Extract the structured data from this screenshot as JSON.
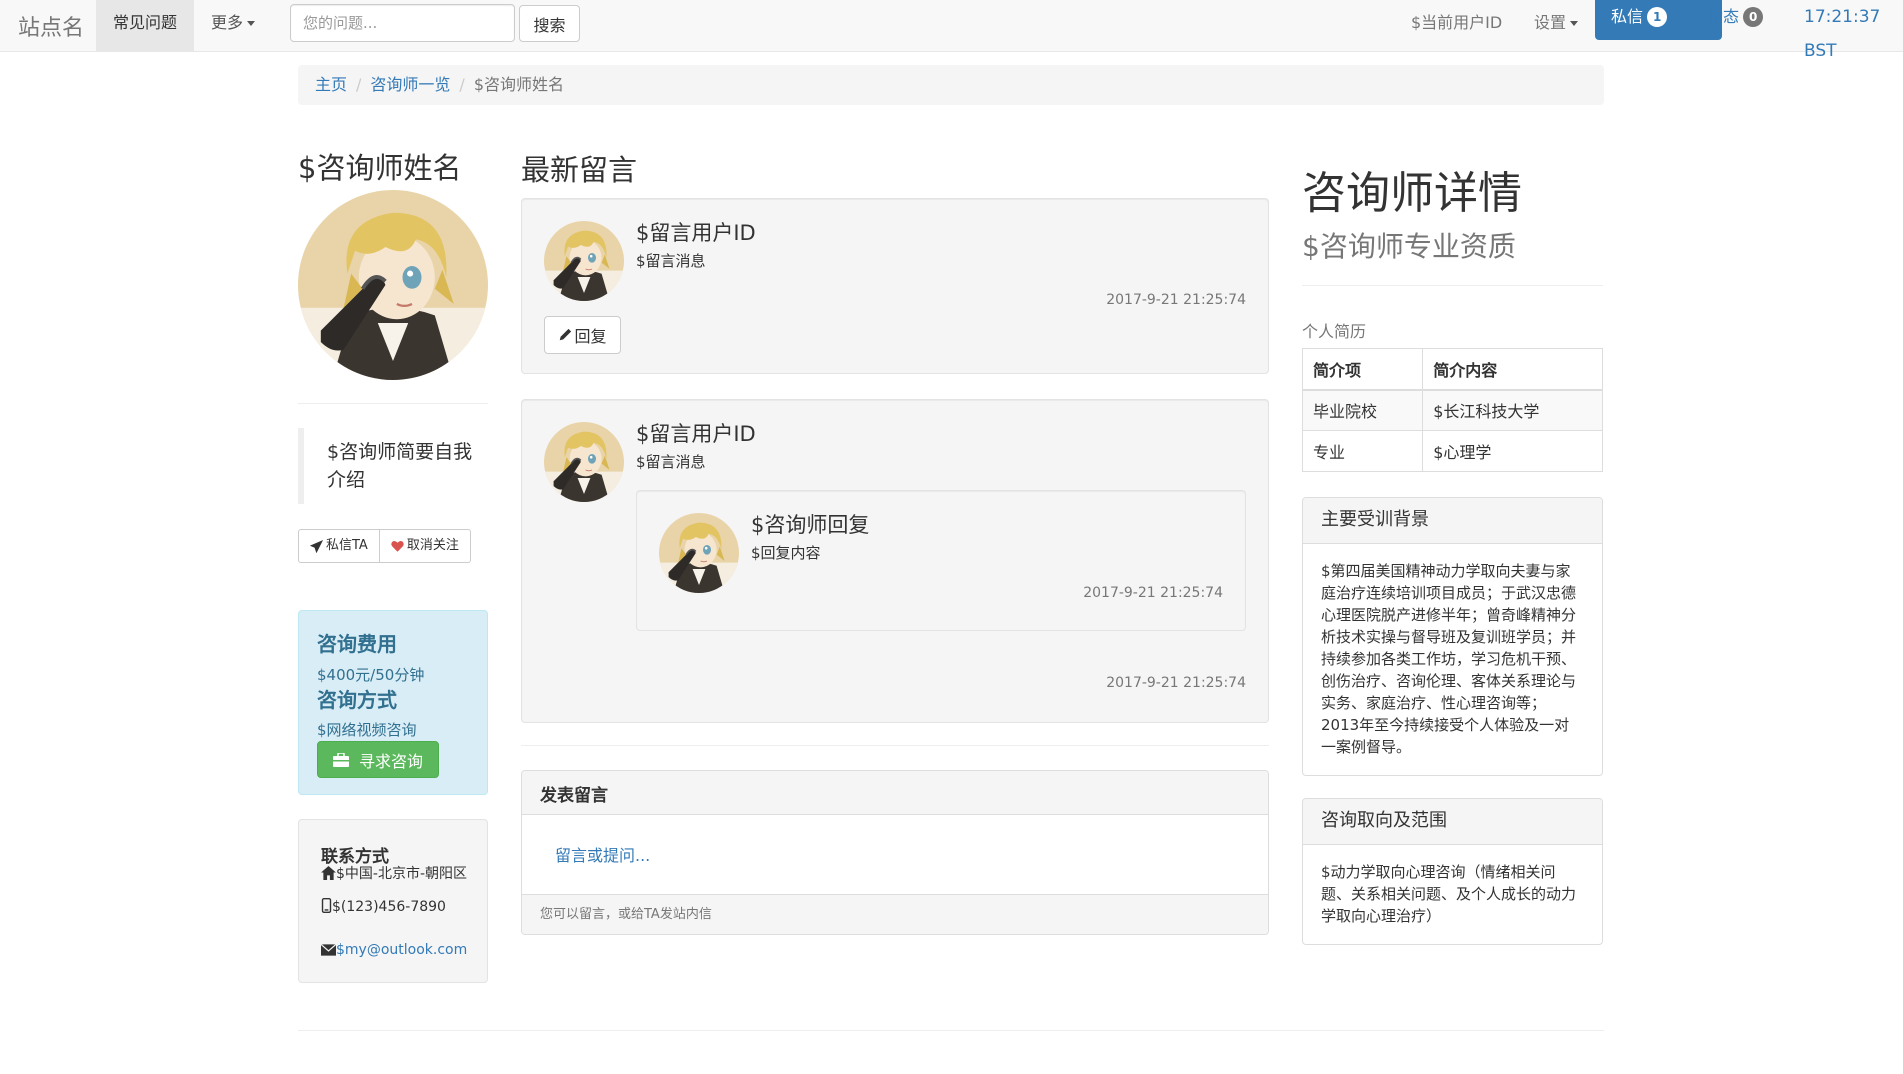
{
  "navbar": {
    "brand": "站点名",
    "faq": "常见问题",
    "more": "更多",
    "search_placeholder": "您的问题...",
    "search_button": "搜索",
    "current_user": "$当前用户ID",
    "settings": "设置",
    "messages": "私信",
    "messages_count": "1",
    "activity": "动态",
    "activity_count": "0",
    "time": "17:21:37 BST"
  },
  "breadcrumb": {
    "home": "主页",
    "list": "咨询师一览",
    "current": "$咨询师姓名"
  },
  "profile": {
    "name": "$咨询师姓名",
    "intro": "$咨询师简要自我介绍",
    "dm_button": "私信TA",
    "unfollow_button": "取消关注",
    "fee_title": "咨询费用",
    "fee_value": "$400元/50分钟",
    "method_title": "咨询方式",
    "method_value": "$网络视频咨询",
    "consult_button": "寻求咨询",
    "contact_title": "联系方式",
    "address": "$中国-北京市-朝阳区",
    "phone": "$(123)456-7890",
    "email": "$my@outlook.com"
  },
  "messages": {
    "title": "最新留言",
    "items": [
      {
        "user": "$留言用户ID",
        "text": "$留言消息",
        "time": "2017-9-21 21:25:74",
        "reply_button": "回复"
      },
      {
        "user": "$留言用户ID",
        "text": "$留言消息",
        "time": "2017-9-21 21:25:74",
        "reply": {
          "user": "$咨询师回复",
          "text": "$回复内容",
          "time": "2017-9-21 21:25:74"
        }
      }
    ]
  },
  "post": {
    "title": "发表留言",
    "link": "留言或提问...",
    "footer": "您可以留言，或给TA发站内信"
  },
  "details": {
    "title": "咨询师详情",
    "subtitle": "$咨询师专业资质",
    "bio_label": "个人简历",
    "table_headers": [
      "简介项",
      "简介内容"
    ],
    "table_rows": [
      [
        "毕业院校",
        "$长江科技大学"
      ],
      [
        "专业",
        "$心理学"
      ]
    ],
    "training_title": "主要受训背景",
    "training_text": "$第四届美国精神动力学取向夫妻与家庭治疗连续培训项目成员；于武汉忠德心理医院脱产进修半年；曾奇峰精神分析技术实操与督导班及复训班学员；并持续参加各类工作坊，学习危机干预、创伤治疗、咨询伦理、客体关系理论与实务、家庭治疗、性心理咨询等；2013年至今持续接受个人体验及一对一案例督导。",
    "scope_title": "咨询取向及范围",
    "scope_text": "$动力学取向心理咨询（情绪相关问题、关系相关问题、及个人成长的动力学取向心理治疗）"
  },
  "colors": {
    "primary": "#337ab7",
    "success": "#5cb85c",
    "info_bg": "#d9edf7",
    "info_text": "#31708f",
    "heart": "#d9534f"
  }
}
